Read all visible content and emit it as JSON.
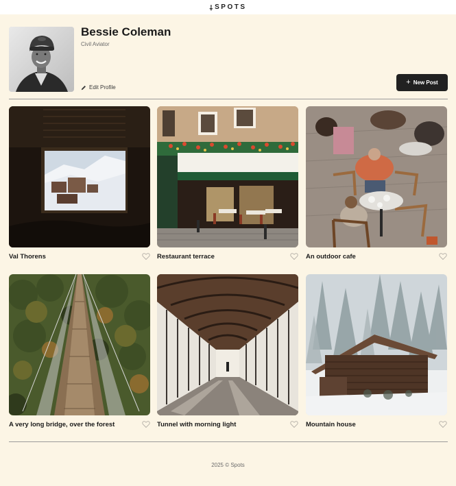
{
  "header": {
    "logo_mark": "⸸",
    "logo_text": "SPOTS"
  },
  "profile": {
    "name": "Bessie Coleman",
    "role": "Civil Aviator",
    "edit_label": "Edit Profile",
    "new_post_label": "New Post",
    "new_post_icon": "+"
  },
  "cards": [
    {
      "title": "Val Thorens"
    },
    {
      "title": "Restaurant terrace"
    },
    {
      "title": "An outdoor cafe"
    },
    {
      "title": "A very long bridge, over the forest"
    },
    {
      "title": "Tunnel with morning light"
    },
    {
      "title": "Mountain house"
    }
  ],
  "footer": {
    "text": "2025 © Spots"
  },
  "colors": {
    "background": "#fcf5e5",
    "button": "#212121",
    "divider": "#9a9a9a"
  }
}
